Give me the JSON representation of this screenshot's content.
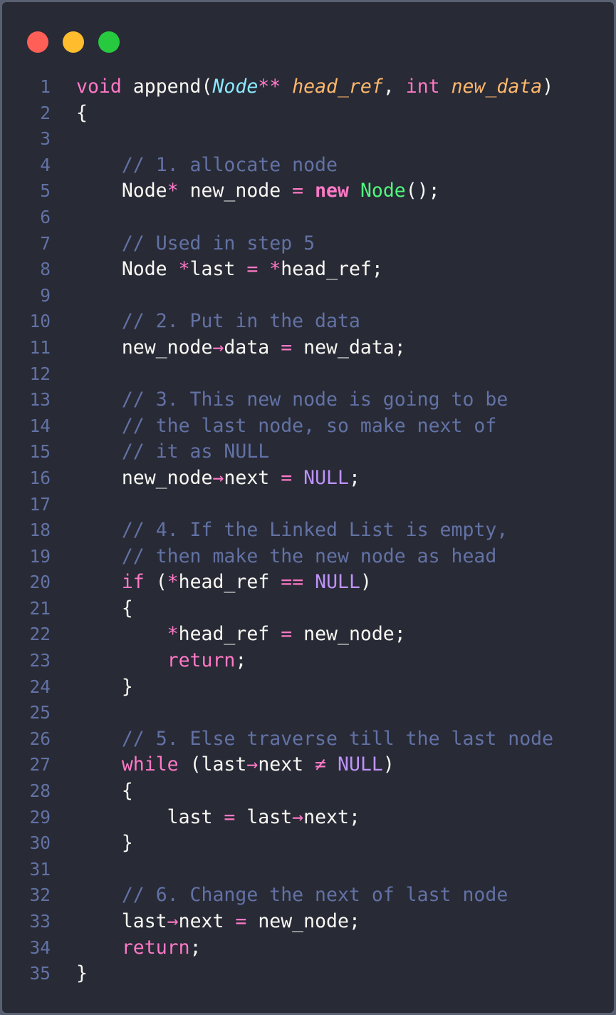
{
  "window": {
    "controls": [
      {
        "name": "close",
        "color": "#ff5f56"
      },
      {
        "name": "minimize",
        "color": "#ffbd2e"
      },
      {
        "name": "maximize",
        "color": "#27c93f"
      }
    ]
  },
  "code": {
    "lines": [
      {
        "n": "1",
        "tokens": [
          [
            "kw",
            "void"
          ],
          [
            "plain",
            " append("
          ],
          [
            "type",
            "Node"
          ],
          [
            "op",
            "**"
          ],
          [
            "plain",
            " "
          ],
          [
            "param",
            "head_ref"
          ],
          [
            "plain",
            ", "
          ],
          [
            "kw",
            "int"
          ],
          [
            "plain",
            " "
          ],
          [
            "param",
            "new_data"
          ],
          [
            "plain",
            ")"
          ]
        ]
      },
      {
        "n": "2",
        "tokens": [
          [
            "plain",
            "{"
          ]
        ]
      },
      {
        "n": "3",
        "tokens": []
      },
      {
        "n": "4",
        "tokens": [
          [
            "plain",
            "    "
          ],
          [
            "cmt",
            "// 1. allocate node"
          ]
        ]
      },
      {
        "n": "5",
        "tokens": [
          [
            "plain",
            "    Node"
          ],
          [
            "op",
            "*"
          ],
          [
            "plain",
            " new_node "
          ],
          [
            "op",
            "="
          ],
          [
            "plain",
            " "
          ],
          [
            "kwb",
            "new"
          ],
          [
            "plain",
            " "
          ],
          [
            "cls",
            "Node"
          ],
          [
            "plain",
            "();"
          ]
        ]
      },
      {
        "n": "6",
        "tokens": []
      },
      {
        "n": "7",
        "tokens": [
          [
            "plain",
            "    "
          ],
          [
            "cmt",
            "// Used in step 5"
          ]
        ]
      },
      {
        "n": "8",
        "tokens": [
          [
            "plain",
            "    Node "
          ],
          [
            "op",
            "*"
          ],
          [
            "plain",
            "last "
          ],
          [
            "op",
            "="
          ],
          [
            "plain",
            " "
          ],
          [
            "op",
            "*"
          ],
          [
            "plain",
            "head_ref;"
          ]
        ]
      },
      {
        "n": "9",
        "tokens": []
      },
      {
        "n": "10",
        "tokens": [
          [
            "plain",
            "    "
          ],
          [
            "cmt",
            "// 2. Put in the data"
          ]
        ]
      },
      {
        "n": "11",
        "tokens": [
          [
            "plain",
            "    new_node"
          ],
          [
            "op",
            "→"
          ],
          [
            "plain",
            "data "
          ],
          [
            "op",
            "="
          ],
          [
            "plain",
            " new_data;"
          ]
        ]
      },
      {
        "n": "12",
        "tokens": []
      },
      {
        "n": "13",
        "tokens": [
          [
            "plain",
            "    "
          ],
          [
            "cmt",
            "// 3. This new node is going to be"
          ]
        ]
      },
      {
        "n": "14",
        "tokens": [
          [
            "plain",
            "    "
          ],
          [
            "cmt",
            "// the last node, so make next of"
          ]
        ]
      },
      {
        "n": "15",
        "tokens": [
          [
            "plain",
            "    "
          ],
          [
            "cmt",
            "// it as NULL"
          ]
        ]
      },
      {
        "n": "16",
        "tokens": [
          [
            "plain",
            "    new_node"
          ],
          [
            "op",
            "→"
          ],
          [
            "plain",
            "next "
          ],
          [
            "op",
            "="
          ],
          [
            "plain",
            " "
          ],
          [
            "const",
            "NULL"
          ],
          [
            "plain",
            ";"
          ]
        ]
      },
      {
        "n": "17",
        "tokens": []
      },
      {
        "n": "18",
        "tokens": [
          [
            "plain",
            "    "
          ],
          [
            "cmt",
            "// 4. If the Linked List is empty,"
          ]
        ]
      },
      {
        "n": "19",
        "tokens": [
          [
            "plain",
            "    "
          ],
          [
            "cmt",
            "// then make the new node as head"
          ]
        ]
      },
      {
        "n": "20",
        "tokens": [
          [
            "plain",
            "    "
          ],
          [
            "kw",
            "if"
          ],
          [
            "plain",
            " ("
          ],
          [
            "op",
            "*"
          ],
          [
            "plain",
            "head_ref "
          ],
          [
            "op",
            "=="
          ],
          [
            "plain",
            " "
          ],
          [
            "const",
            "NULL"
          ],
          [
            "plain",
            ")"
          ]
        ]
      },
      {
        "n": "21",
        "tokens": [
          [
            "plain",
            "    {"
          ]
        ]
      },
      {
        "n": "22",
        "tokens": [
          [
            "plain",
            "        "
          ],
          [
            "op",
            "*"
          ],
          [
            "plain",
            "head_ref "
          ],
          [
            "op",
            "="
          ],
          [
            "plain",
            " new_node;"
          ]
        ]
      },
      {
        "n": "23",
        "tokens": [
          [
            "plain",
            "        "
          ],
          [
            "kw",
            "return"
          ],
          [
            "plain",
            ";"
          ]
        ]
      },
      {
        "n": "24",
        "tokens": [
          [
            "plain",
            "    }"
          ]
        ]
      },
      {
        "n": "25",
        "tokens": []
      },
      {
        "n": "26",
        "tokens": [
          [
            "plain",
            "    "
          ],
          [
            "cmt",
            "// 5. Else traverse till the last node"
          ]
        ]
      },
      {
        "n": "27",
        "tokens": [
          [
            "plain",
            "    "
          ],
          [
            "kw",
            "while"
          ],
          [
            "plain",
            " (last"
          ],
          [
            "op",
            "→"
          ],
          [
            "plain",
            "next "
          ],
          [
            "op",
            "≠"
          ],
          [
            "plain",
            " "
          ],
          [
            "const",
            "NULL"
          ],
          [
            "plain",
            ")"
          ]
        ]
      },
      {
        "n": "28",
        "tokens": [
          [
            "plain",
            "    {"
          ]
        ]
      },
      {
        "n": "29",
        "tokens": [
          [
            "plain",
            "        last "
          ],
          [
            "op",
            "="
          ],
          [
            "plain",
            " last"
          ],
          [
            "op",
            "→"
          ],
          [
            "plain",
            "next;"
          ]
        ]
      },
      {
        "n": "30",
        "tokens": [
          [
            "plain",
            "    }"
          ]
        ]
      },
      {
        "n": "31",
        "tokens": []
      },
      {
        "n": "32",
        "tokens": [
          [
            "plain",
            "    "
          ],
          [
            "cmt",
            "// 6. Change the next of last node"
          ]
        ]
      },
      {
        "n": "33",
        "tokens": [
          [
            "plain",
            "    last"
          ],
          [
            "op",
            "→"
          ],
          [
            "plain",
            "next "
          ],
          [
            "op",
            "="
          ],
          [
            "plain",
            " new_node;"
          ]
        ]
      },
      {
        "n": "34",
        "tokens": [
          [
            "plain",
            "    "
          ],
          [
            "kw",
            "return"
          ],
          [
            "plain",
            ";"
          ]
        ]
      },
      {
        "n": "35",
        "tokens": [
          [
            "plain",
            "}"
          ]
        ]
      }
    ]
  }
}
